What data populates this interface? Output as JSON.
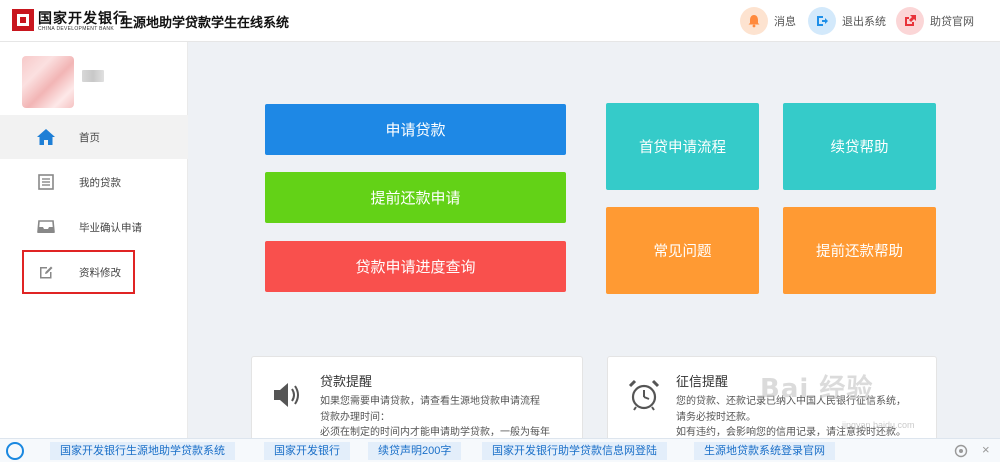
{
  "header": {
    "bank_name": "国家开发银行",
    "bank_name_en": "CHINA DEVELOPMENT BANK",
    "system_title": "生源地助学贷款学生在线系统",
    "actions": [
      {
        "label": "消息",
        "icon": "bell-icon",
        "color": "#ff8a3d"
      },
      {
        "label": "退出系统",
        "icon": "logout-icon",
        "color": "#1e8fe8"
      },
      {
        "label": "助贷官网",
        "icon": "external-link-icon",
        "color": "#e8333a"
      }
    ]
  },
  "sidebar": {
    "items": [
      {
        "label": "首页",
        "icon": "home-icon",
        "active": true
      },
      {
        "label": "我的贷款",
        "icon": "list-document-icon",
        "active": false
      },
      {
        "label": "毕业确认申请",
        "icon": "inbox-tray-icon",
        "active": false
      },
      {
        "label": "资料修改",
        "icon": "edit-icon",
        "active": false
      }
    ]
  },
  "main": {
    "primary_buttons": [
      {
        "label": "申请贷款",
        "color": "#1e88e5"
      },
      {
        "label": "提前还款申请",
        "color": "#63d217"
      },
      {
        "label": "贷款申请进度查询",
        "color": "#f9504d"
      }
    ],
    "tiles": [
      {
        "label": "首贷申请流程",
        "color": "#35cbc9"
      },
      {
        "label": "续贷帮助",
        "color": "#35cbc9"
      },
      {
        "label": "常见问题",
        "color": "#ff9a33"
      },
      {
        "label": "提前还款帮助",
        "color": "#ff9a33"
      }
    ]
  },
  "cards": [
    {
      "title": "贷款提醒",
      "icon": "speaker-icon",
      "lines": [
        "如果您需要申请贷款，请查看生源地贷款申请流程",
        "贷款办理时间：",
        "必须在制定的时间内才能申请助学贷款，一般为每年"
      ]
    },
    {
      "title": "征信提醒",
      "icon": "alarm-clock-icon",
      "lines": [
        "您的贷款、还款记录已纳入中国人民银行征信系统，",
        "请务必按时还款。",
        "如有违约，会影响您的信用记录，请注意按时还款。"
      ]
    }
  ],
  "watermark": {
    "text": "Bai 经验",
    "sub": "jingyan.baidu.com"
  },
  "bottom_bar": {
    "links": [
      "国家开发银行生源地助学贷款系统",
      "国家开发银行",
      "续贷声明200字",
      "国家开发银行助学贷款信息网登陆",
      "生源地贷款系统登录官网"
    ],
    "close": "×"
  }
}
